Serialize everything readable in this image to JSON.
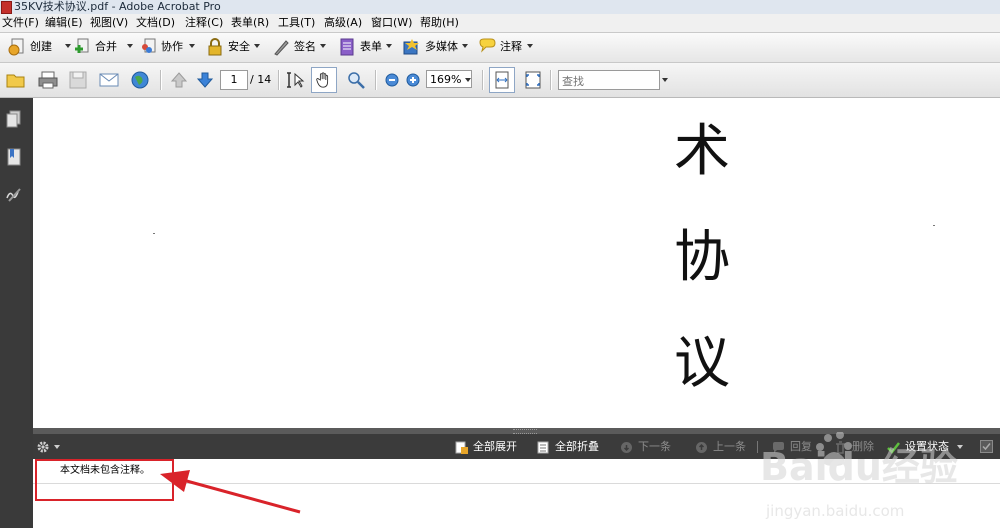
{
  "window": {
    "title": "35KV技术协议.pdf - Adobe Acrobat Pro"
  },
  "menubar": {
    "items": [
      "文件(F)",
      "编辑(E)",
      "视图(V)",
      "文档(D)",
      "注释(C)",
      "表单(R)",
      "工具(T)",
      "高级(A)",
      "窗口(W)",
      "帮助(H)"
    ]
  },
  "toolbar": {
    "create": "创建",
    "combine": "合并",
    "collaborate": "协作",
    "secure": "安全",
    "sign": "签名",
    "forms": "表单",
    "multimedia": "多媒体",
    "comment": "注释"
  },
  "navigation": {
    "current_page": "1",
    "total_pages": "/ 14",
    "zoom": "169%",
    "search_placeholder": "查找"
  },
  "document": {
    "characters": [
      "术",
      "协",
      "议"
    ]
  },
  "comments": {
    "expand_all": "全部展开",
    "collapse_all": "全部折叠",
    "next": "下一条",
    "previous": "上一条",
    "reply": "回复",
    "delete": "删除",
    "set_status": "设置状态",
    "empty_message": "本文档未包含注释。"
  },
  "watermark": {
    "brand": "Baidu经验",
    "url": "jingyan.baidu.com"
  },
  "colors": {
    "annotation": "#d9232a",
    "panel_dark": "#3b3b3b",
    "nav_dark": "#3a3a3a"
  }
}
